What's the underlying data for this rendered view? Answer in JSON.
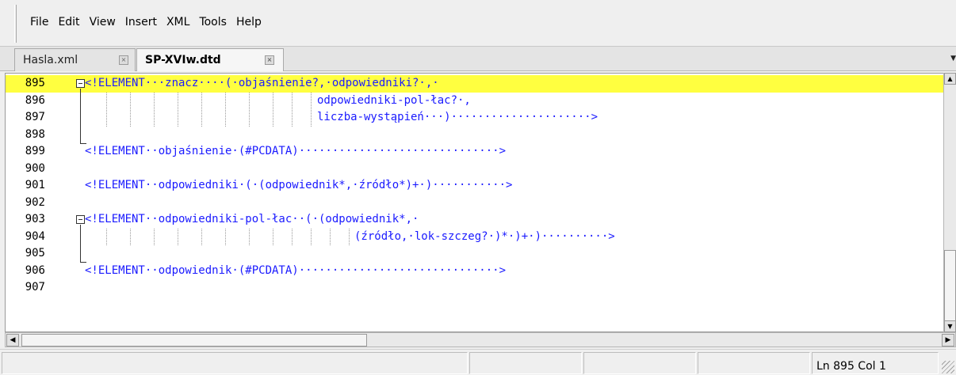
{
  "menu": [
    "File",
    "Edit",
    "View",
    "Insert",
    "XML",
    "Tools",
    "Help"
  ],
  "tabs": [
    {
      "label": "Hasla.xml",
      "active": false
    },
    {
      "label": "SP-XVIw.dtd",
      "active": true
    }
  ],
  "editor": {
    "current_line": "895",
    "lines": [
      {
        "number": "895",
        "text": "<!ELEMENT···znacz····(·objaśnienie?,·odpowiedniki?·,·"
      },
      {
        "number": "896",
        "text": "odpowiedniki-pol-łac?·,"
      },
      {
        "number": "897",
        "text": "liczba-wystąpień···)·····················>"
      },
      {
        "number": "898",
        "text": ""
      },
      {
        "number": "899",
        "text": "<!ELEMENT··objaśnienie·(#PCDATA)······························>"
      },
      {
        "number": "900",
        "text": ""
      },
      {
        "number": "901",
        "text": "<!ELEMENT··odpowiedniki·(·(odpowiednik*,·źródło*)+·)···········>"
      },
      {
        "number": "902",
        "text": ""
      },
      {
        "number": "903",
        "text": "<!ELEMENT··odpowiedniki-pol-łac··(·(odpowiednik*,·"
      },
      {
        "number": "904",
        "text": "(źródło,·lok-szczeg?·)*·)+·)··········>"
      },
      {
        "number": "905",
        "text": ""
      },
      {
        "number": "906",
        "text": "<!ELEMENT··odpowiednik·(#PCDATA)······························>"
      },
      {
        "number": "907",
        "text": ""
      }
    ]
  },
  "status": {
    "position": "Ln 895 Col 1"
  },
  "colors": {
    "highlight": "#ffff40",
    "code_text": "#1a1aff"
  }
}
